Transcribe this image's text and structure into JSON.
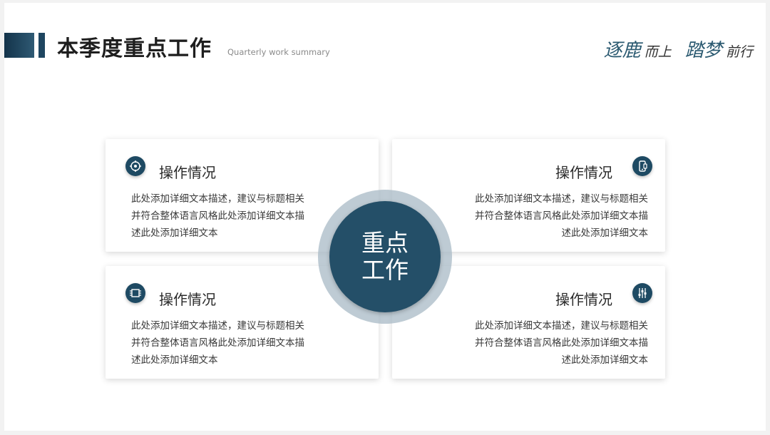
{
  "header": {
    "title": "本季度重点工作",
    "subtitle": "Quarterly work summary",
    "slogan": {
      "word1": "逐鹿",
      "word2": "而上",
      "word3": "踏梦",
      "word4": "前行"
    }
  },
  "center": {
    "line1": "重点",
    "line2": "工作"
  },
  "cards": [
    {
      "title": "操作情况",
      "icon": "target-icon",
      "text": "此处添加详细文本描述，建议与标题相关并符合整体语言风格此处添加详细文本描述此处添加详细文本"
    },
    {
      "title": "操作情况",
      "icon": "mobile-device-icon",
      "text": "此处添加详细文本描述，建议与标题相关并符合整体语言风格此处添加详细文本描述此处添加详细文本"
    },
    {
      "title": "操作情况",
      "icon": "chip-icon",
      "text": "此处添加详细文本描述，建议与标题相关并符合整体语言风格此处添加详细文本描述此处添加详细文本"
    },
    {
      "title": "操作情况",
      "icon": "sliders-icon",
      "text": "此处添加详细文本描述，建议与标题相关并符合整体语言风格此处添加详细文本描述此处添加详细文本"
    }
  ],
  "colors": {
    "accent_dark": "#1e4a63",
    "accent_ring": "#a8bac5",
    "title_text": "#1e1e1e",
    "slogan_accent": "#2a5970"
  }
}
